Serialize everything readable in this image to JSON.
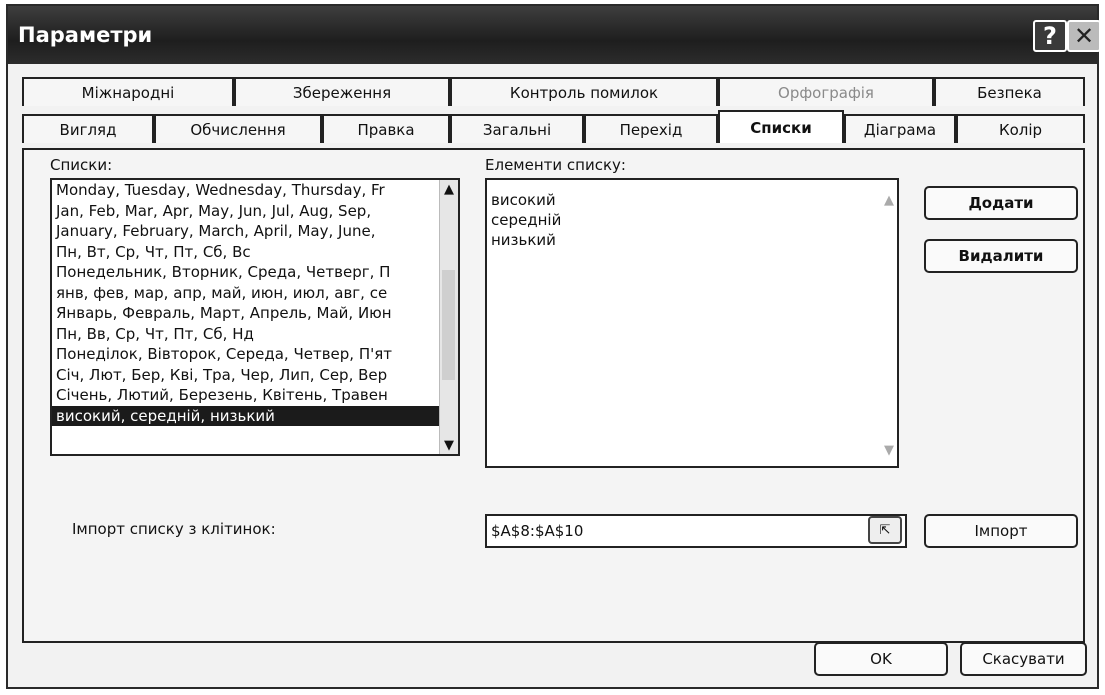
{
  "window": {
    "title": "Параметри",
    "help_glyph": "?",
    "close_glyph": "✕"
  },
  "tabs": {
    "row1": [
      {
        "label": "Міжнародні",
        "disabled": false
      },
      {
        "label": "Збереження",
        "disabled": false
      },
      {
        "label": "Контроль помилок",
        "disabled": false
      },
      {
        "label": "Орфографія",
        "disabled": true
      },
      {
        "label": "Безпека",
        "disabled": false
      }
    ],
    "row2": [
      {
        "label": "Вигляд",
        "active": false
      },
      {
        "label": "Обчислення",
        "active": false
      },
      {
        "label": "Правка",
        "active": false
      },
      {
        "label": "Загальні",
        "active": false
      },
      {
        "label": "Перехід",
        "active": false
      },
      {
        "label": "Списки",
        "active": true
      },
      {
        "label": "Діаграма",
        "active": false
      },
      {
        "label": "Колір",
        "active": false
      }
    ]
  },
  "lists": {
    "label": "Списки:",
    "items": [
      "Monday, Tuesday, Wednesday, Thursday, Fr",
      "Jan, Feb, Mar, Apr, May, Jun, Jul, Aug, Sep,",
      "January, February, March, April, May, June,",
      "Пн, Вт, Ср, Чт, Пт, Сб, Вс",
      "Понедельник, Вторник, Среда, Четверг, П",
      "янв, фев, мар, апр, май, июн, июл, авг, се",
      "Январь, Февраль, Март, Апрель, Май, Июн",
      "Пн, Вв, Ср, Чт, Пт, Сб, Нд",
      "Понеділок, Вівторок, Середа, Четвер, П'ят",
      "Січ, Лют, Бер, Кві, Тра, Чер, Лип, Сер, Вер",
      "Січень, Лютий, Березень, Квітень, Травен",
      "високий, середній, низький"
    ],
    "selected_index": 11,
    "scroll_up": "▲",
    "scroll_down": "▼"
  },
  "elements": {
    "label": "Елементи списку:",
    "lines": [
      "високий",
      "середній",
      "низький"
    ],
    "scroll_up": "▲",
    "scroll_down": "▼"
  },
  "buttons": {
    "add": "Додати",
    "delete": "Видалити",
    "import": "Імпорт",
    "ok": "OK",
    "cancel": "Скасувати"
  },
  "import": {
    "label": "Імпорт списку з клітинок:",
    "value": "$A$8:$A$10",
    "collapse_glyph": "⇱"
  }
}
